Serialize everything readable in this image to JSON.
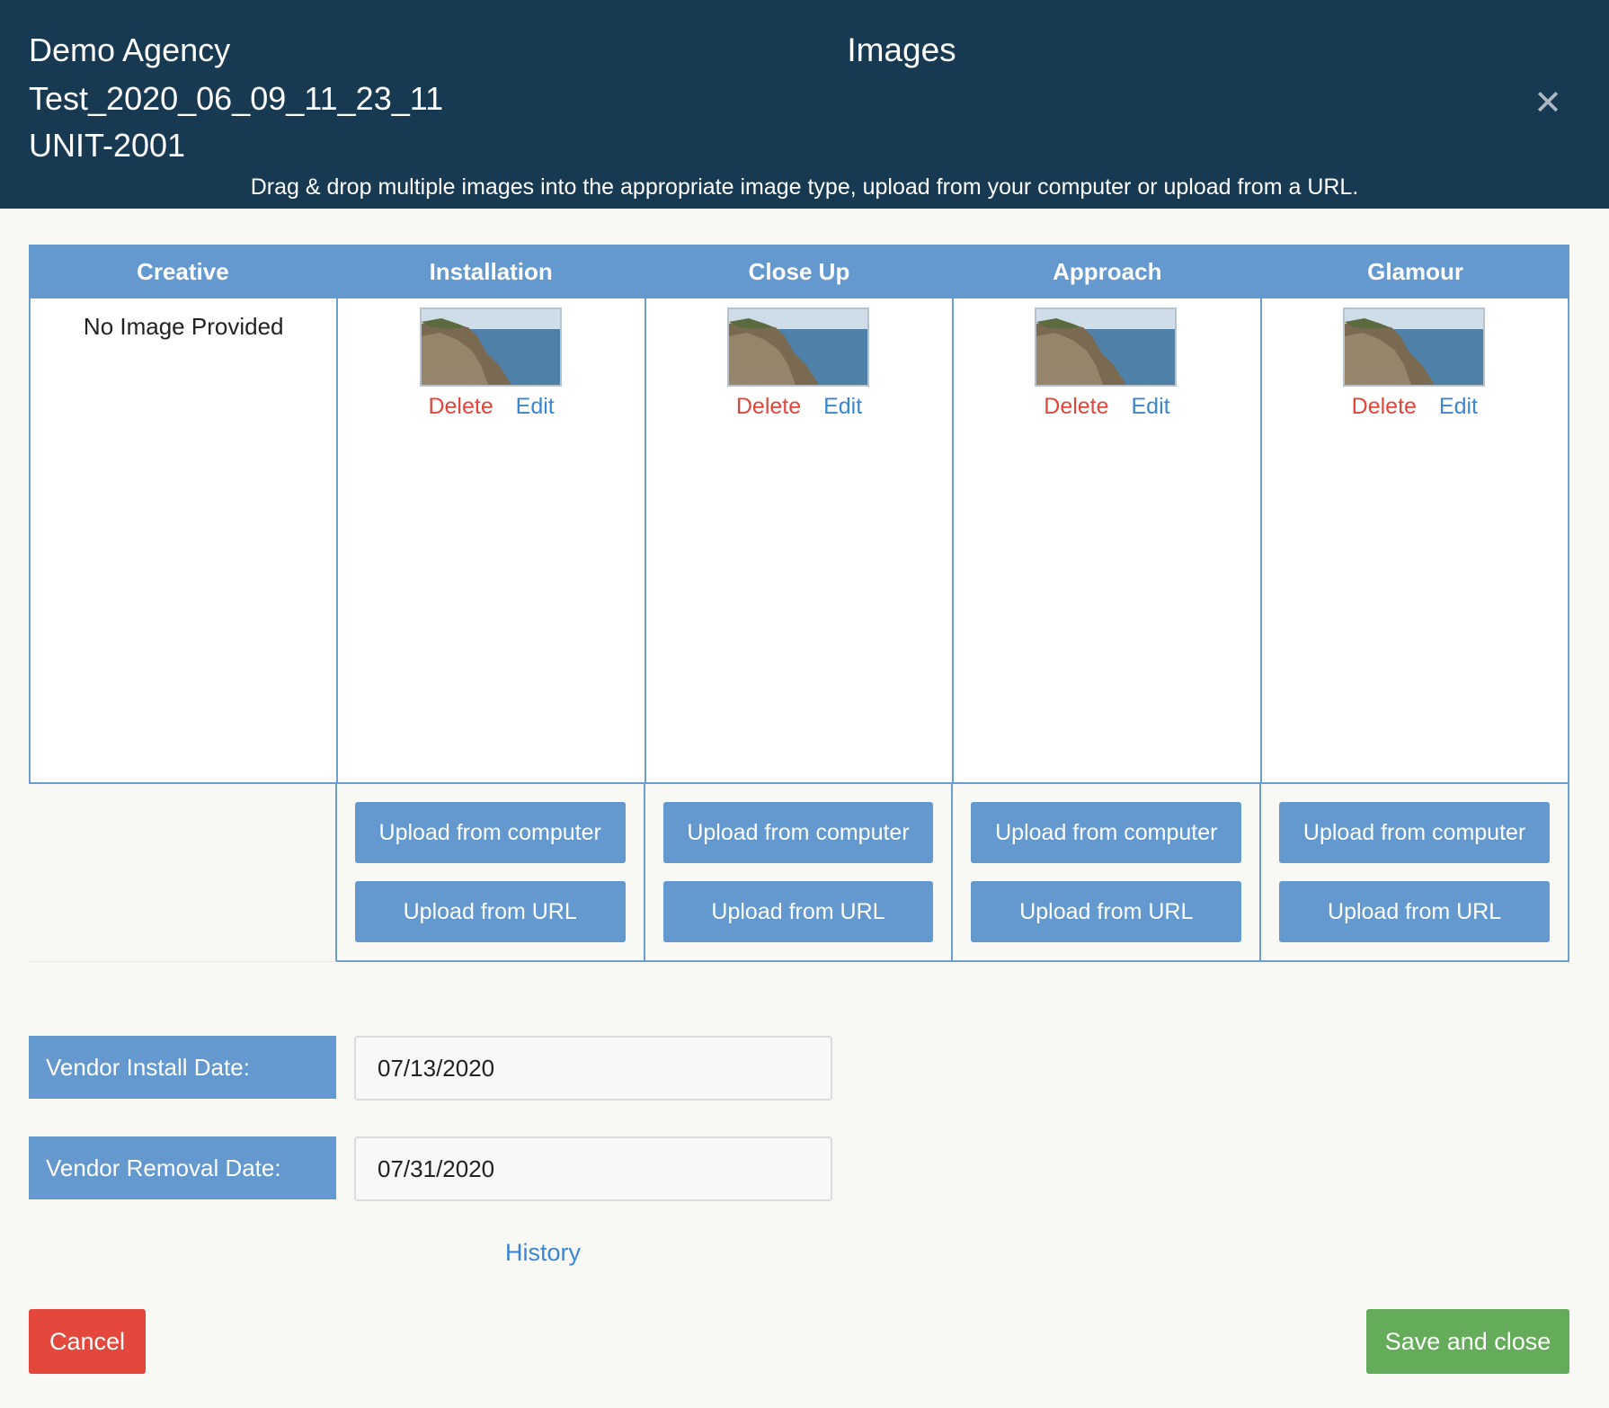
{
  "header": {
    "agency": "Demo Agency",
    "campaign": "Test_2020_06_09_11_23_11",
    "unit": "UNIT-2001",
    "title": "Images",
    "close_icon": "close-icon",
    "instructions": "Drag & drop multiple images into the appropriate image type, upload from your computer or upload from a URL."
  },
  "columns": [
    {
      "label": "Creative",
      "empty_text": "No Image Provided"
    },
    {
      "label": "Installation",
      "delete_label": "Delete",
      "edit_label": "Edit",
      "upload_computer": "Upload from computer",
      "upload_url": "Upload from URL"
    },
    {
      "label": "Close Up",
      "delete_label": "Delete",
      "edit_label": "Edit",
      "upload_computer": "Upload from computer",
      "upload_url": "Upload from URL"
    },
    {
      "label": "Approach",
      "delete_label": "Delete",
      "edit_label": "Edit",
      "upload_computer": "Upload from computer",
      "upload_url": "Upload from URL"
    },
    {
      "label": "Glamour",
      "delete_label": "Delete",
      "edit_label": "Edit",
      "upload_computer": "Upload from computer",
      "upload_url": "Upload from URL"
    }
  ],
  "dates": {
    "install_label": "Vendor Install Date:",
    "install_value": "07/13/2020",
    "removal_label": "Vendor Removal Date:",
    "removal_value": "07/31/2020"
  },
  "history_label": "History",
  "footer": {
    "cancel_label": "Cancel",
    "save_label": "Save and close"
  },
  "colors": {
    "header_bg": "#173a52",
    "accent_blue": "#6499cf",
    "link_blue": "#3a86d4",
    "delete_red": "#e2463a",
    "cancel_red": "#e4473b",
    "save_green": "#65ac5a"
  }
}
